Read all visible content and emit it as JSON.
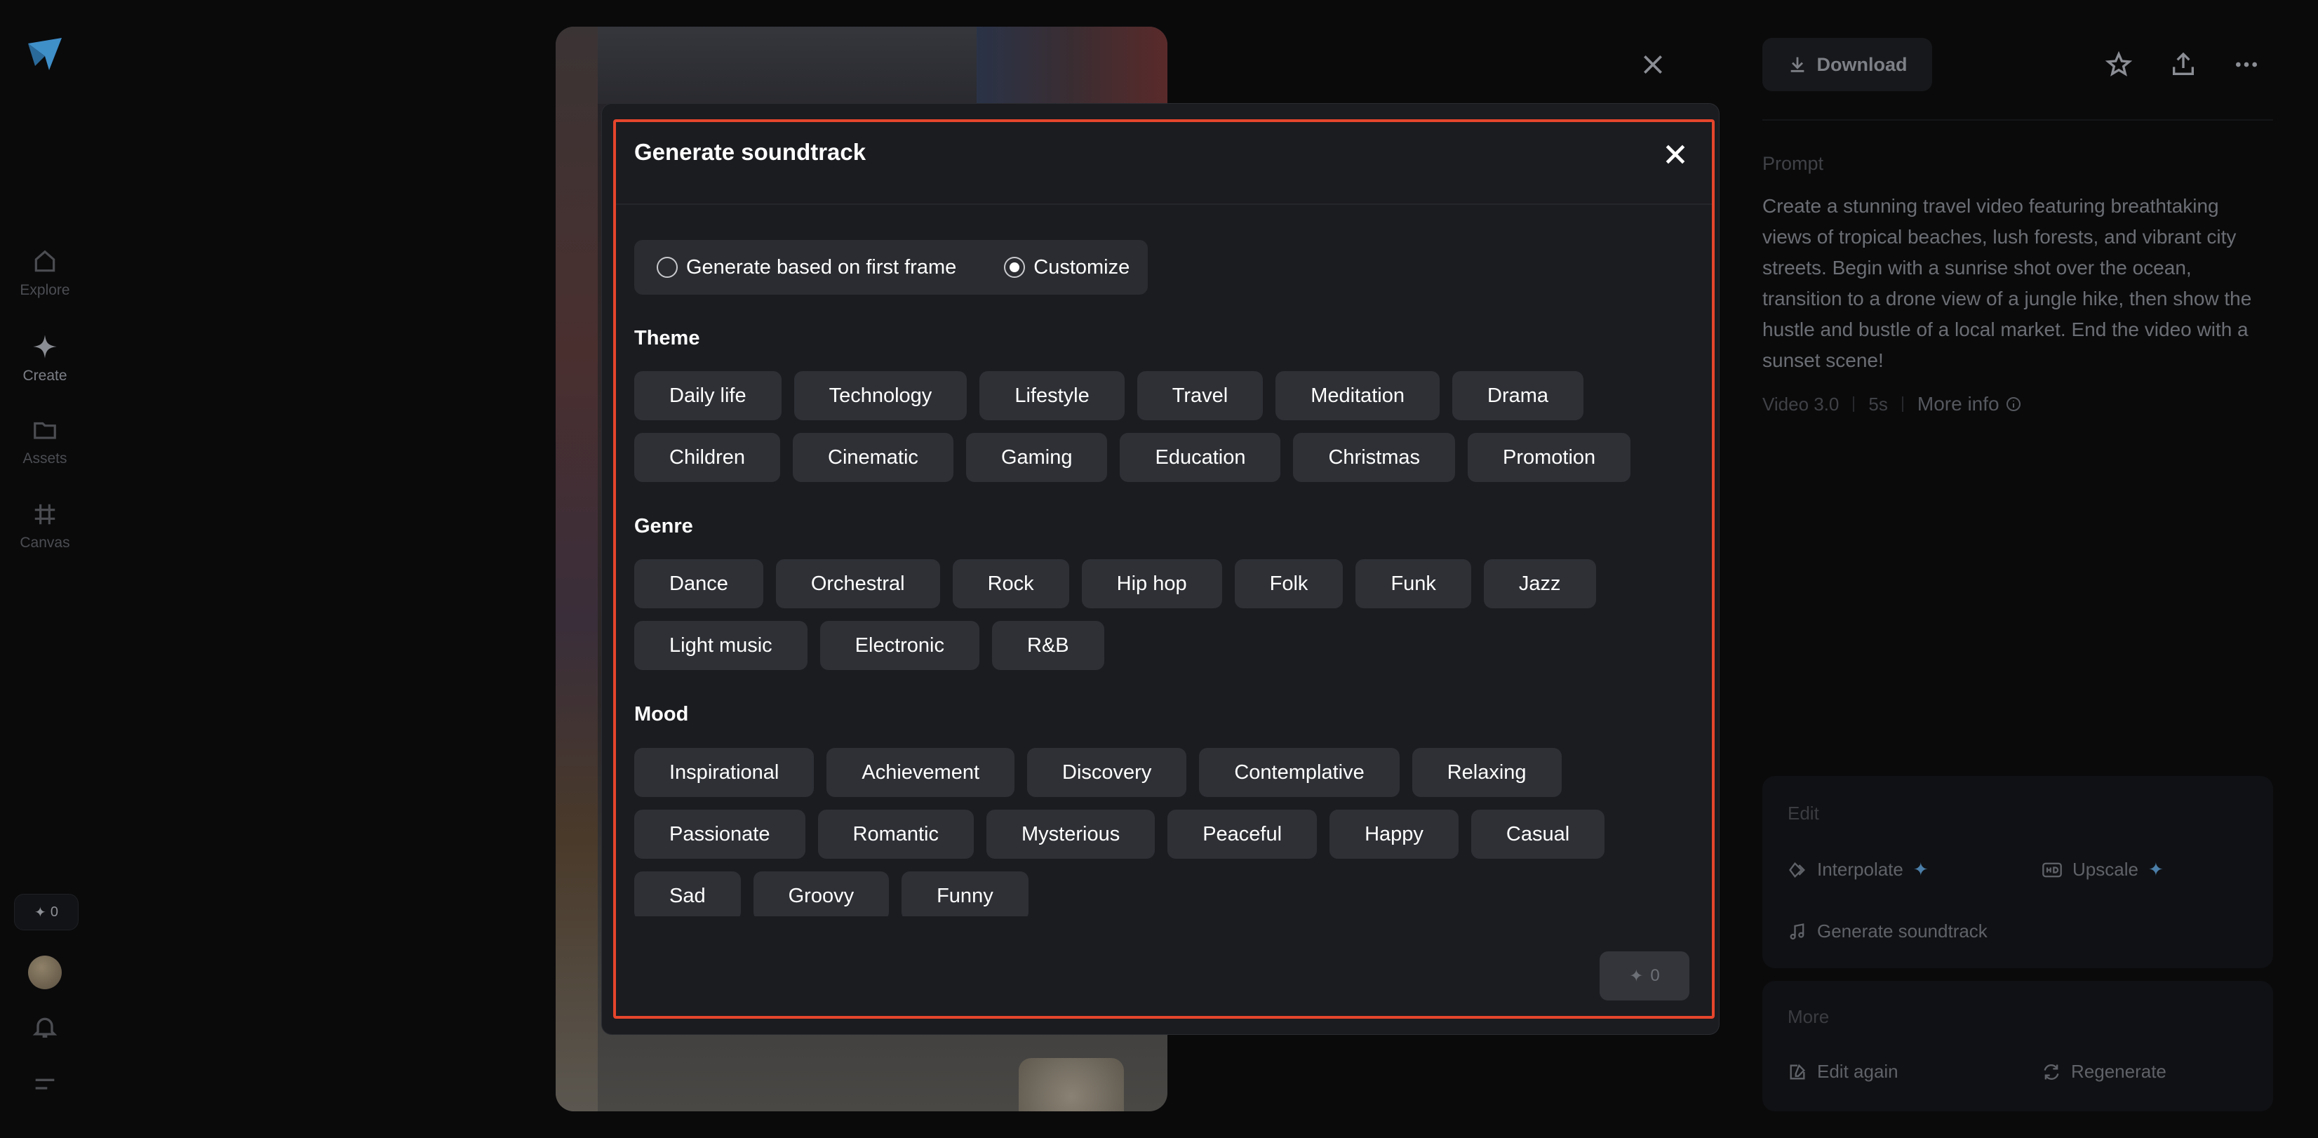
{
  "sidebar": {
    "items": [
      {
        "label": "Explore",
        "icon": "home-icon"
      },
      {
        "label": "Create",
        "icon": "sparkle-icon"
      },
      {
        "label": "Assets",
        "icon": "folder-icon"
      },
      {
        "label": "Canvas",
        "icon": "canvas-icon"
      }
    ],
    "credits": "0"
  },
  "right_panel": {
    "download_label": "Download",
    "prompt_title": "Prompt",
    "prompt_text": "Create a stunning travel video featuring breathtaking views of tropical beaches, lush forests, and vibrant city streets. Begin with a sunrise shot over the ocean, transition to a drone view of a jungle hike, then show the hustle and bustle of a local market. End the video with a sunset scene!",
    "model": "Video 3.0",
    "duration": "5s",
    "more_info": "More info",
    "edit": {
      "title": "Edit",
      "interpolate": "Interpolate",
      "upscale": "Upscale",
      "soundtrack": "Generate soundtrack"
    },
    "more": {
      "title": "More",
      "edit_again": "Edit again",
      "regenerate": "Regenerate"
    }
  },
  "modal": {
    "title": "Generate soundtrack",
    "mode_options": {
      "first_frame": "Generate based on first frame",
      "customize": "Customize",
      "selected": "customize"
    },
    "theme_title": "Theme",
    "theme_row1": [
      "Daily life",
      "Technology",
      "Lifestyle",
      "Travel",
      "Meditation",
      "Drama"
    ],
    "theme_row2": [
      "Children",
      "Cinematic",
      "Gaming",
      "Education",
      "Christmas",
      "Promotion"
    ],
    "genre_title": "Genre",
    "genre_row1": [
      "Dance",
      "Orchestral",
      "Rock",
      "Hip hop",
      "Folk",
      "Funk",
      "Jazz"
    ],
    "genre_row2": [
      "Light music",
      "Electronic",
      "R&B"
    ],
    "mood_title": "Mood",
    "mood_row1": [
      "Inspirational",
      "Achievement",
      "Discovery",
      "Contemplative",
      "Relaxing"
    ],
    "mood_row2": [
      "Passionate",
      "Romantic",
      "Mysterious",
      "Peaceful",
      "Happy",
      "Casual"
    ],
    "mood_row3": [
      "Sad",
      "Groovy",
      "Funny"
    ],
    "submit_cost": "0"
  },
  "colors": {
    "accent_outline": "#e5452c",
    "chip_bg": "#2e3036",
    "modal_bg": "#1b1c20"
  }
}
